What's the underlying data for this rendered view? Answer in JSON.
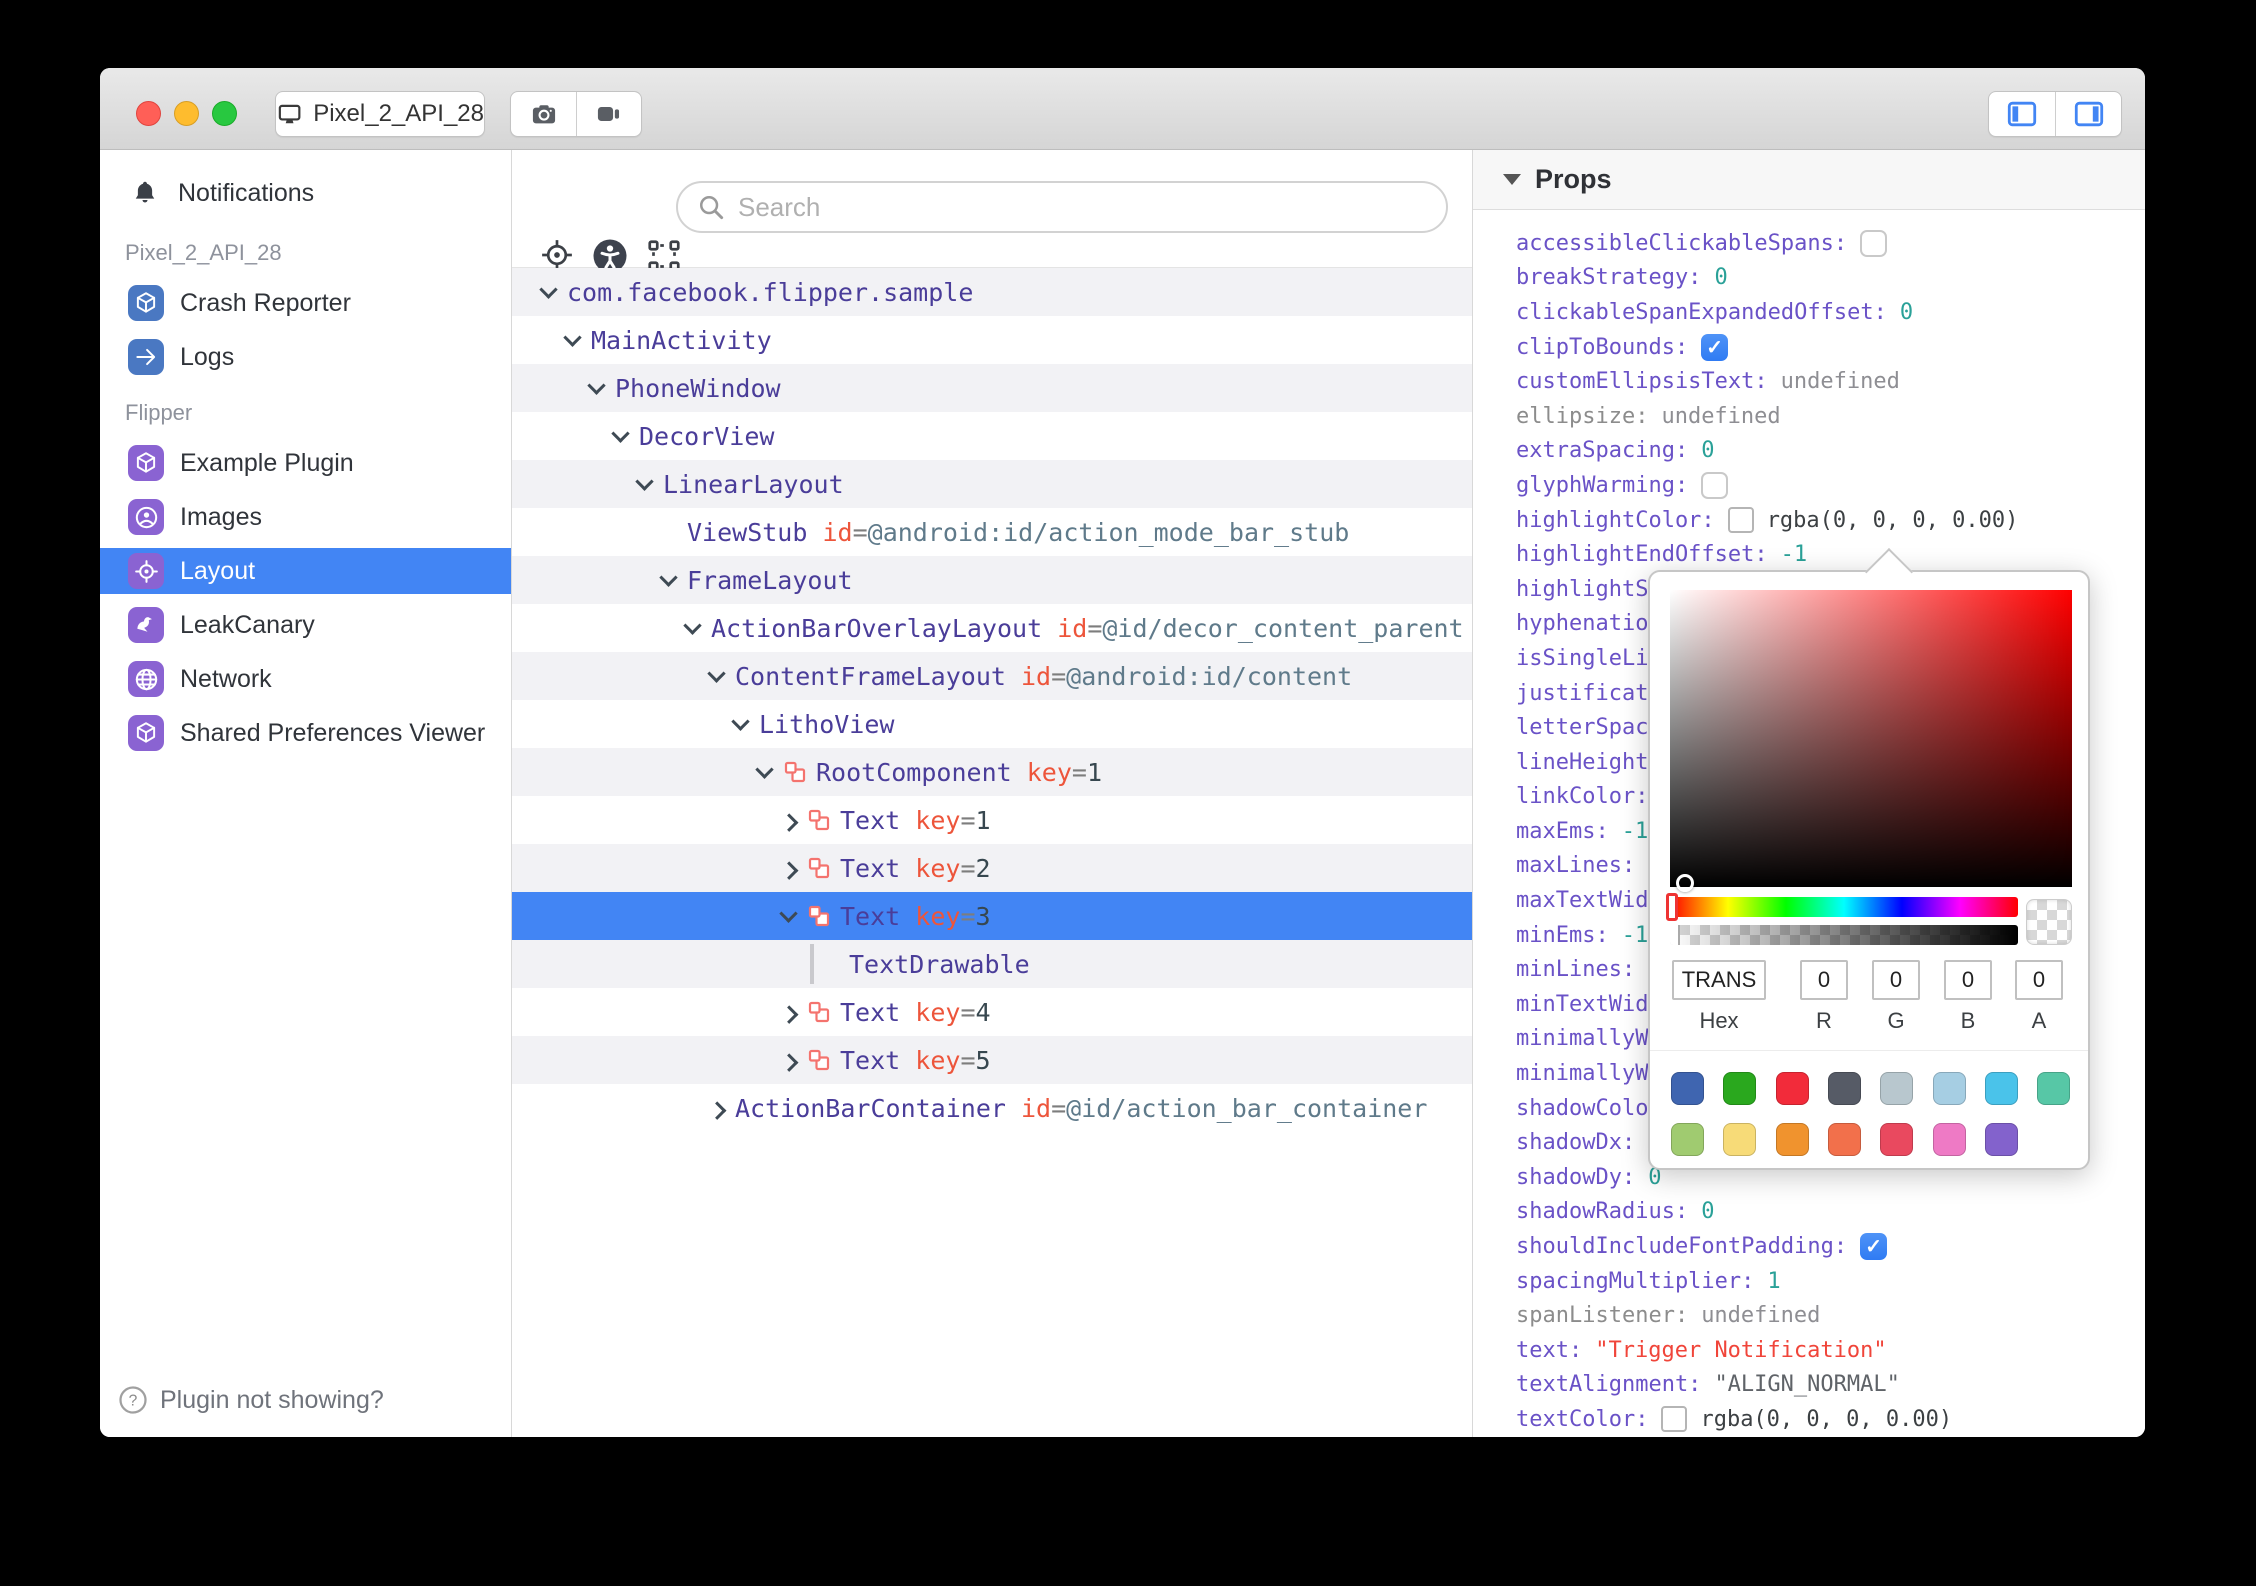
{
  "titlebar": {
    "device": "Pixel_2_API_28"
  },
  "sidebar": {
    "notifications_label": "Notifications",
    "sections": [
      {
        "header": "Pixel_2_API_28",
        "items": [
          {
            "id": "crash-reporter",
            "label": "Crash Reporter",
            "icon": "cube-icon",
            "color": "#4a78c2"
          },
          {
            "id": "logs",
            "label": "Logs",
            "icon": "arrow-right-icon",
            "color": "#4a78c2"
          }
        ]
      },
      {
        "header": "Flipper",
        "items": [
          {
            "id": "example-plugin",
            "label": "Example Plugin",
            "icon": "cube-icon",
            "color": "#8a63d2"
          },
          {
            "id": "images",
            "label": "Images",
            "icon": "user-circle-icon",
            "color": "#8a63d2"
          },
          {
            "id": "layout",
            "label": "Layout",
            "icon": "target-icon",
            "color": "#8a63d2",
            "selected": true
          },
          {
            "id": "leakcanary",
            "label": "LeakCanary",
            "icon": "bird-icon",
            "color": "#8a63d2"
          },
          {
            "id": "network",
            "label": "Network",
            "icon": "globe-icon",
            "color": "#8a63d2"
          },
          {
            "id": "shared-preferences",
            "label": "Shared Preferences Viewer",
            "icon": "cube-icon",
            "color": "#8a63d2"
          }
        ]
      }
    ],
    "footer_label": "Plugin not showing?"
  },
  "toolbar": {
    "search_placeholder": "Search"
  },
  "tree": {
    "rows": [
      {
        "depth": 0,
        "chevron": "down",
        "name": "com.facebook.flipper.sample",
        "attrs": []
      },
      {
        "depth": 1,
        "chevron": "down",
        "name": "MainActivity",
        "attrs": []
      },
      {
        "depth": 2,
        "chevron": "down",
        "name": "PhoneWindow",
        "attrs": []
      },
      {
        "depth": 3,
        "chevron": "down",
        "name": "DecorView",
        "attrs": []
      },
      {
        "depth": 4,
        "chevron": "down",
        "name": "LinearLayout",
        "attrs": []
      },
      {
        "depth": 5,
        "chevron": "none",
        "name": "ViewStub",
        "attrs": [
          {
            "k": "id",
            "v": "@android:id/action_mode_bar_stub",
            "vt": "path"
          }
        ]
      },
      {
        "depth": 5,
        "chevron": "down",
        "name": "FrameLayout",
        "attrs": []
      },
      {
        "depth": 6,
        "chevron": "down",
        "name": "ActionBarOverlayLayout",
        "attrs": [
          {
            "k": "id",
            "v": "@id/decor_content_parent",
            "vt": "path"
          }
        ]
      },
      {
        "depth": 7,
        "chevron": "down",
        "name": "ContentFrameLayout",
        "attrs": [
          {
            "k": "id",
            "v": "@android:id/content",
            "vt": "path"
          }
        ]
      },
      {
        "depth": 8,
        "chevron": "down",
        "name": "LithoView",
        "attrs": []
      },
      {
        "depth": 9,
        "chevron": "down",
        "litho": true,
        "name": "RootComponent",
        "attrs": [
          {
            "k": "key",
            "v": "1",
            "vt": "num"
          }
        ]
      },
      {
        "depth": 10,
        "chevron": "right",
        "litho": true,
        "name": "Text",
        "attrs": [
          {
            "k": "key",
            "v": "1",
            "vt": "num"
          }
        ]
      },
      {
        "depth": 10,
        "chevron": "right",
        "litho": true,
        "name": "Text",
        "attrs": [
          {
            "k": "key",
            "v": "2",
            "vt": "num"
          }
        ]
      },
      {
        "depth": 10,
        "chevron": "down",
        "litho": true,
        "name": "Text",
        "attrs": [
          {
            "k": "key",
            "v": "3",
            "vt": "num"
          }
        ],
        "selected": true
      },
      {
        "depth": 11,
        "chevron": "pipe",
        "name": "TextDrawable",
        "attrs": []
      },
      {
        "depth": 10,
        "chevron": "right",
        "litho": true,
        "name": "Text",
        "attrs": [
          {
            "k": "key",
            "v": "4",
            "vt": "num"
          }
        ]
      },
      {
        "depth": 10,
        "chevron": "right",
        "litho": true,
        "name": "Text",
        "attrs": [
          {
            "k": "key",
            "v": "5",
            "vt": "num"
          }
        ]
      },
      {
        "depth": 7,
        "chevron": "right",
        "name": "ActionBarContainer",
        "attrs": [
          {
            "k": "id",
            "v": "@id/action_bar_container",
            "vt": "path"
          }
        ]
      }
    ]
  },
  "props": {
    "title": "Props",
    "rows": [
      {
        "key": "accessibleClickableSpans:",
        "type": "checkbox",
        "checked": false
      },
      {
        "key": "breakStrategy:",
        "type": "num",
        "value": "0"
      },
      {
        "key": "clickableSpanExpandedOffset:",
        "type": "num",
        "value": "0"
      },
      {
        "key": "clipToBounds:",
        "type": "checkbox",
        "checked": true
      },
      {
        "key": "customEllipsisText:",
        "type": "undef",
        "value": "undefined"
      },
      {
        "key": "ellipsize:",
        "type": "undef",
        "value": "undefined",
        "gray": true
      },
      {
        "key": "extraSpacing:",
        "type": "num",
        "value": "0"
      },
      {
        "key": "glyphWarming:",
        "type": "checkbox",
        "checked": false
      },
      {
        "key": "highlightColor:",
        "type": "color",
        "value": "rgba(0, 0, 0, 0.00)"
      },
      {
        "key": "highlightEndOffset:",
        "type": "num",
        "value": "-1"
      },
      {
        "key": "highlightS",
        "type": "frag"
      },
      {
        "key": "hyphenatio",
        "type": "frag"
      },
      {
        "key": "isSingleLi",
        "type": "frag"
      },
      {
        "key": "justificat",
        "type": "frag"
      },
      {
        "key": "letterSpac",
        "type": "frag"
      },
      {
        "key": "lineHeight",
        "type": "frag"
      },
      {
        "key": "linkColor:",
        "type": "frag"
      },
      {
        "key": "maxEms:",
        "type": "num",
        "value": "-1"
      },
      {
        "key": "maxLines:",
        "type": "frag"
      },
      {
        "key": "maxTextWid",
        "type": "frag"
      },
      {
        "key": "minEms:",
        "type": "num",
        "value": "-1"
      },
      {
        "key": "minLines:",
        "type": "frag"
      },
      {
        "key": "minTextWid",
        "type": "frag"
      },
      {
        "key": "minimallyW",
        "type": "frag"
      },
      {
        "key": "minimallyW",
        "type": "frag"
      },
      {
        "key": "shadowColo",
        "type": "frag"
      },
      {
        "key": "shadowDx:",
        "type": "frag"
      },
      {
        "key": "shadowDy:",
        "type": "num",
        "value": "0"
      },
      {
        "key": "shadowRadius:",
        "type": "num",
        "value": "0"
      },
      {
        "key": "shouldIncludeFontPadding:",
        "type": "checkbox",
        "checked": true
      },
      {
        "key": "spacingMultiplier:",
        "type": "num",
        "value": "1"
      },
      {
        "key": "spanListener:",
        "type": "undef",
        "value": "undefined",
        "gray": true
      },
      {
        "key": "text:",
        "type": "str",
        "value": "\"Trigger Notification\""
      },
      {
        "key": "textAlignment:",
        "type": "enum",
        "value": "\"ALIGN_NORMAL\""
      },
      {
        "key": "textColor:",
        "type": "color",
        "value": "rgba(0, 0, 0, 0.00)"
      }
    ]
  },
  "picker": {
    "hex": "TRANS",
    "r": "0",
    "g": "0",
    "b": "0",
    "a": "0",
    "labels": {
      "hex": "Hex",
      "r": "R",
      "g": "G",
      "b": "B",
      "a": "A"
    },
    "swatches_row1": [
      "#3f65b0",
      "#2aa81e",
      "#f22b3a",
      "#565b66",
      "#b8c7ce",
      "#a6cee3",
      "#4ac3ea",
      "#57c7a6"
    ],
    "swatches_row2": [
      "#a0cb70",
      "#f7db78",
      "#f0932e",
      "#f2704b",
      "#e9495f",
      "#ee7ac5",
      "#8362cc"
    ]
  },
  "colors": {
    "accent": "#4285f4",
    "tree_name": "#4a3d99",
    "attr_key": "#ed553b",
    "prop_key": "#6a52c7",
    "prop_num": "#2aa198",
    "prop_string": "#f0453a"
  }
}
